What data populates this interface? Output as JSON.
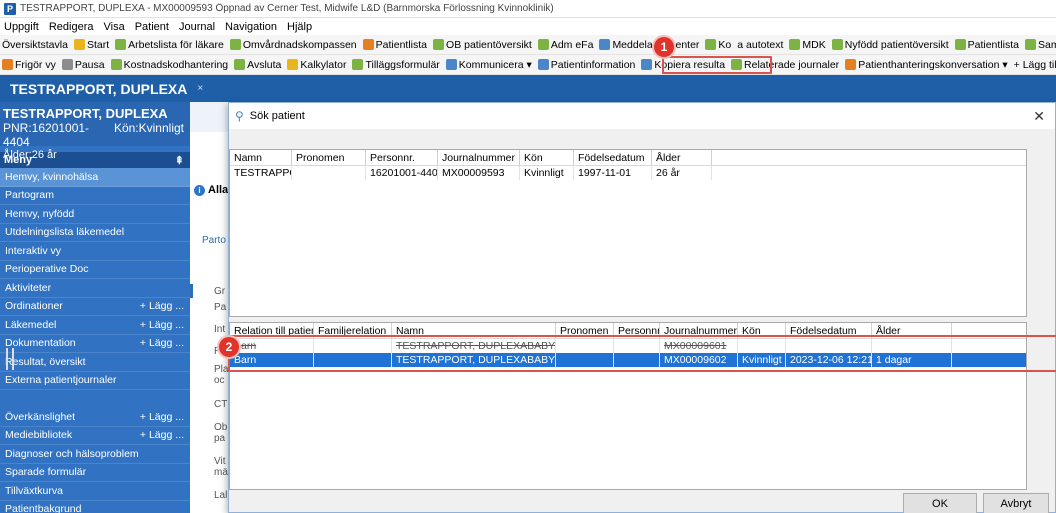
{
  "window": {
    "title": "TESTRAPPORT, DUPLEXA - MX00009593 Öppnad av Cerner Test, Midwife L&D (Barnmorska Förlossning Kvinnoklinik)",
    "app_icon": "P"
  },
  "menubar": [
    "Uppgift",
    "Redigera",
    "Visa",
    "Patient",
    "Journal",
    "Navigation",
    "Hjälp"
  ],
  "toolbar1": [
    {
      "label": "Översiktstavla",
      "icon": "none"
    },
    {
      "label": "Start",
      "icon": "yellow"
    },
    {
      "label": "Arbetslista för läkare",
      "icon": "green"
    },
    {
      "label": "Omvårdnadskompassen",
      "icon": "green"
    },
    {
      "label": "Patientlista",
      "icon": "orange"
    },
    {
      "label": "OB patientöversikt",
      "icon": "green"
    },
    {
      "label": "Adm eFa",
      "icon": "green"
    },
    {
      "label": "Meddelandecenter",
      "icon": "blue"
    },
    {
      "label": "Ko",
      "icon": "green"
    },
    {
      "label": "a autotext",
      "icon": "none"
    },
    {
      "label": "MDK",
      "icon": "green"
    },
    {
      "label": "Nyfödd patientöversikt",
      "icon": "green"
    },
    {
      "label": "Patientlista",
      "icon": "green"
    },
    {
      "label": "Samverkansöversikt",
      "icon": "green"
    },
    {
      "label": "Perso",
      "icon": "orange"
    }
  ],
  "toolbar2": [
    {
      "label": "Frigör vy",
      "icon": "orange"
    },
    {
      "label": "Pausa",
      "icon": "grey"
    },
    {
      "label": "Kostnadskodhantering",
      "icon": "green"
    },
    {
      "label": "Avsluta",
      "icon": "green"
    },
    {
      "label": "Kalkylator",
      "icon": "yellow"
    },
    {
      "label": "Tilläggsformulär",
      "icon": "green"
    },
    {
      "label": "Kommunicera ▾",
      "icon": "blue"
    },
    {
      "label": "Patientinformation",
      "icon": "blue"
    },
    {
      "label": "Kopiera resulta",
      "icon": "blue"
    },
    {
      "label": "Relaterade journaler",
      "icon": "green"
    },
    {
      "label": "Patienthanteringskonversation ▾",
      "icon": "orange"
    },
    {
      "label": "+ Lägg till ▾",
      "icon": "none"
    },
    {
      "label": "Batchregistrering",
      "icon": "blue"
    }
  ],
  "annotations": {
    "badge1": "1",
    "badge2": "2"
  },
  "patient_tab": {
    "label": "TESTRAPPORT, DUPLEXA",
    "close": "×"
  },
  "patient": {
    "name": "TESTRAPPORT, DUPLEXA",
    "pnr": "PNR:16201001-4404",
    "kon": "Kön:Kvinnligt",
    "age": "Ålder:26 år"
  },
  "sidebar": {
    "menu_title": "Meny",
    "pin": "⇞",
    "items": [
      {
        "label": "Hemvy, kvinnohälsa",
        "add": "",
        "active": true
      },
      {
        "label": "Partogram",
        "add": ""
      },
      {
        "label": "Hemvy, nyfödd",
        "add": ""
      },
      {
        "label": "Utdelningslista läkemedel",
        "add": ""
      },
      {
        "label": "Interaktiv vy",
        "add": ""
      },
      {
        "label": "Perioperative Doc",
        "add": ""
      },
      {
        "label": "Aktiviteter",
        "add": ""
      },
      {
        "label": "Ordinationer",
        "add": "+ Lägg ..."
      },
      {
        "label": "Läkemedel",
        "add": "+ Lägg ..."
      },
      {
        "label": "Dokumentation",
        "add": "+ Lägg ..."
      },
      {
        "label": "Resultat, översikt",
        "add": ""
      },
      {
        "label": "Externa patientjournaler",
        "add": ""
      }
    ],
    "items2": [
      {
        "label": "Överkänslighet",
        "add": "+ Lägg ..."
      },
      {
        "label": "Mediebibliotek",
        "add": "+ Lägg ..."
      },
      {
        "label": "Diagnoser och hälsoproblem",
        "add": ""
      },
      {
        "label": "Sparade formulär",
        "add": ""
      },
      {
        "label": "Tillväxtkurva",
        "add": ""
      },
      {
        "label": "Patientbakgrund",
        "add": ""
      }
    ]
  },
  "workarea": {
    "alla": "Alla",
    "parto": "Parto",
    "snippets": [
      "Gr",
      "Pa",
      "Int",
      "Ra",
      "Pla",
      "oc",
      "CT",
      "Ob",
      "pa",
      "Vit",
      "mä",
      "Lal"
    ]
  },
  "dialog": {
    "title": "Sök patient",
    "close": "✕",
    "grid1": {
      "columns": [
        "Namn",
        "Pronomen",
        "Personnr.",
        "Journalnummer",
        "Kön",
        "Födelsedatum",
        "Ålder"
      ],
      "rows": [
        [
          "TESTRAPPORT, DUPLEXA",
          "",
          "16201001-4404",
          "MX00009593",
          "Kvinnligt",
          "1997-11-01",
          "26 år"
        ]
      ]
    },
    "grid2": {
      "columns": [
        "Relation till patient",
        "Familjerelation",
        "Namn",
        "Pronomen",
        "Personnr.",
        "Journalnummer",
        "Kön",
        "Födelsedatum",
        "Ålder"
      ],
      "rows": [
        [
          "Barn",
          "",
          "TESTRAPPORT, DUPLEXABABYA",
          "",
          "",
          "MX00009601",
          "",
          "",
          ""
        ],
        [
          "Barn",
          "",
          "TESTRAPPORT, DUPLEXABABYB",
          "",
          "",
          "MX00009602",
          "Kvinnligt",
          "2023-12-06 12:21",
          "1 dagar"
        ]
      ]
    },
    "ok_label": "OK",
    "cancel_label": "Avbryt"
  }
}
